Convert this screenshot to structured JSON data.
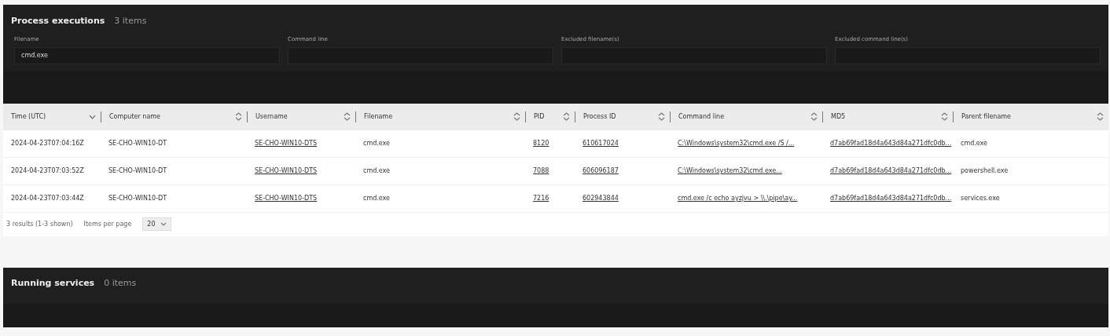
{
  "process_panel": {
    "title": "Process executions",
    "count": "3 items",
    "filters": [
      {
        "label": "Filename",
        "value": "cmd.exe"
      },
      {
        "label": "Command line"
      },
      {
        "label": "Excluded filename(s)"
      },
      {
        "label": "Excluded command line(s)"
      }
    ]
  },
  "table": {
    "columns": [
      {
        "label": "Time (UTC)",
        "sorted": true,
        "kind": "text"
      },
      {
        "label": "Computer name",
        "sorted": false,
        "kind": "text"
      },
      {
        "label": "Username",
        "sorted": false,
        "kind": "link"
      },
      {
        "label": "Filename",
        "sorted": false,
        "kind": "text"
      },
      {
        "label": "PID",
        "sorted": false,
        "kind": "link"
      },
      {
        "label": "Process ID",
        "sorted": false,
        "kind": "link"
      },
      {
        "label": "Command line",
        "sorted": false,
        "kind": "link"
      },
      {
        "label": "MD5",
        "sorted": false,
        "kind": "link"
      },
      {
        "label": "Parent filename",
        "sorted": false,
        "kind": "text"
      }
    ],
    "rows": [
      [
        "2024-04-23T07:04:16Z",
        "SE-CHO-WIN10-DT",
        "SE-CHO-WIN10-DTS",
        "cmd.exe",
        "8120",
        "610617024",
        "C:\\Windows\\system32\\cmd.exe /S /...",
        "d7ab69fad18d4a643d84a271dfc0db...",
        "cmd.exe"
      ],
      [
        "2024-04-23T07:03:52Z",
        "SE-CHO-WIN10-DT",
        "SE-CHO-WIN10-DTS",
        "cmd.exe",
        "7088",
        "606096187",
        "C:\\Windows\\system32\\cmd.exe...",
        "d7ab69fad18d4a643d84a271dfc0db...",
        "powershell.exe"
      ],
      [
        "2024-04-23T07:03:44Z",
        "SE-CHO-WIN10-DT",
        "SE-CHO-WIN10-DTS",
        "cmd.exe",
        "7216",
        "602943844",
        "cmd.exe /c echo ayzjvu > \\\\.\\pipe\\ay...",
        "d7ab69fad18d4a643d84a271dfc0db...",
        "services.exe"
      ]
    ],
    "footer": {
      "results": "3 results (1-3 shown)",
      "per_page_label": "Items per page",
      "per_page": "20"
    }
  },
  "services_panel": {
    "title": "Running services",
    "count": "0 items"
  }
}
